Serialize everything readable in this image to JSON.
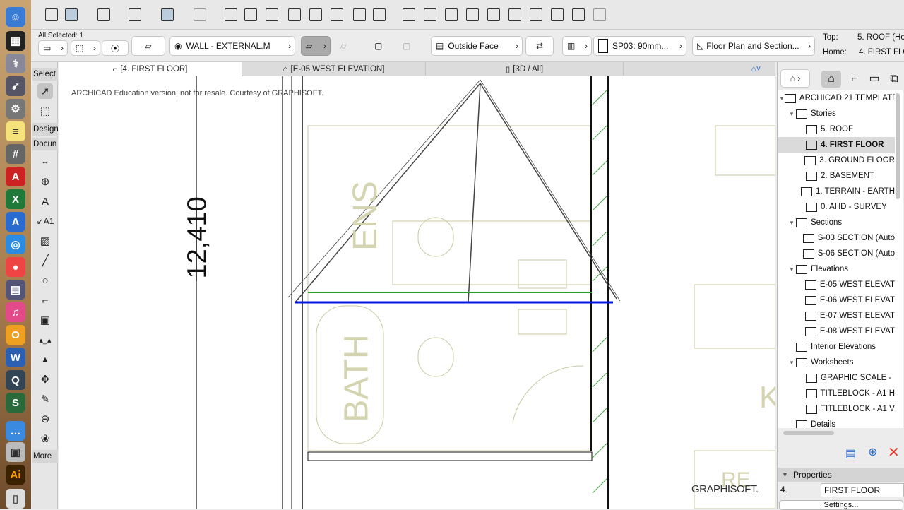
{
  "infobox": {
    "selection": "All Selected: 1",
    "layer": "WALL - EXTERNAL.M",
    "reference_line": "Outside Face",
    "composite": "SP03: 90mm...",
    "floor_plan_display": "Floor Plan and Section...",
    "top_label": "Top:",
    "top_value": "5. ROOF (Ho",
    "home_label": "Home:",
    "home_value": "4. FIRST FLO"
  },
  "tabs": [
    {
      "label": "[4. FIRST FLOOR]"
    },
    {
      "label": "[E-05 WEST ELEVATION]"
    },
    {
      "label": "[3D / All]"
    }
  ],
  "toolbox": {
    "select": "Select",
    "design": "Design",
    "document": "Docun",
    "more": "More"
  },
  "canvas": {
    "watermark": "ARCHICAD Education version, not for resale. Courtesy of GRAPHISOFT.",
    "dimension": "12,410",
    "room1": "ENS",
    "room2": "BATH",
    "room3": "K",
    "room4": "RE",
    "logo": "GRAPHISOFT."
  },
  "navigator": {
    "items": [
      {
        "label": "ARCHICAD 21 TEMPLATE",
        "level": 0,
        "tri": "▼"
      },
      {
        "label": "Stories",
        "level": 1,
        "tri": "▼"
      },
      {
        "label": "5. ROOF",
        "level": 2
      },
      {
        "label": "4. FIRST FLOOR",
        "level": 2,
        "selected": true
      },
      {
        "label": "3. GROUND FLOOR",
        "level": 2
      },
      {
        "label": "2. BASEMENT",
        "level": 2
      },
      {
        "label": "1. TERRAIN - EARTH",
        "level": 2
      },
      {
        "label": "0. AHD - SURVEY",
        "level": 2
      },
      {
        "label": "Sections",
        "level": 1,
        "tri": "▼"
      },
      {
        "label": "S-03 SECTION (Auto",
        "level": 2
      },
      {
        "label": "S-06 SECTION (Auto",
        "level": 2
      },
      {
        "label": "Elevations",
        "level": 1,
        "tri": "▼"
      },
      {
        "label": "E-05 WEST ELEVAT",
        "level": 2
      },
      {
        "label": "E-06 WEST ELEVAT",
        "level": 2
      },
      {
        "label": "E-07 WEST ELEVAT",
        "level": 2
      },
      {
        "label": "E-08 WEST ELEVAT",
        "level": 2
      },
      {
        "label": "Interior Elevations",
        "level": 1
      },
      {
        "label": "Worksheets",
        "level": 1,
        "tri": "▼"
      },
      {
        "label": "GRAPHIC SCALE -",
        "level": 2
      },
      {
        "label": "TITLEBLOCK - A1 H",
        "level": 2
      },
      {
        "label": "TITLEBLOCK - A1 V",
        "level": 2
      },
      {
        "label": "Details",
        "level": 1
      }
    ],
    "properties": "Properties",
    "story_num": "4.",
    "story_name": "FIRST FLOOR",
    "settings": "Settings..."
  }
}
